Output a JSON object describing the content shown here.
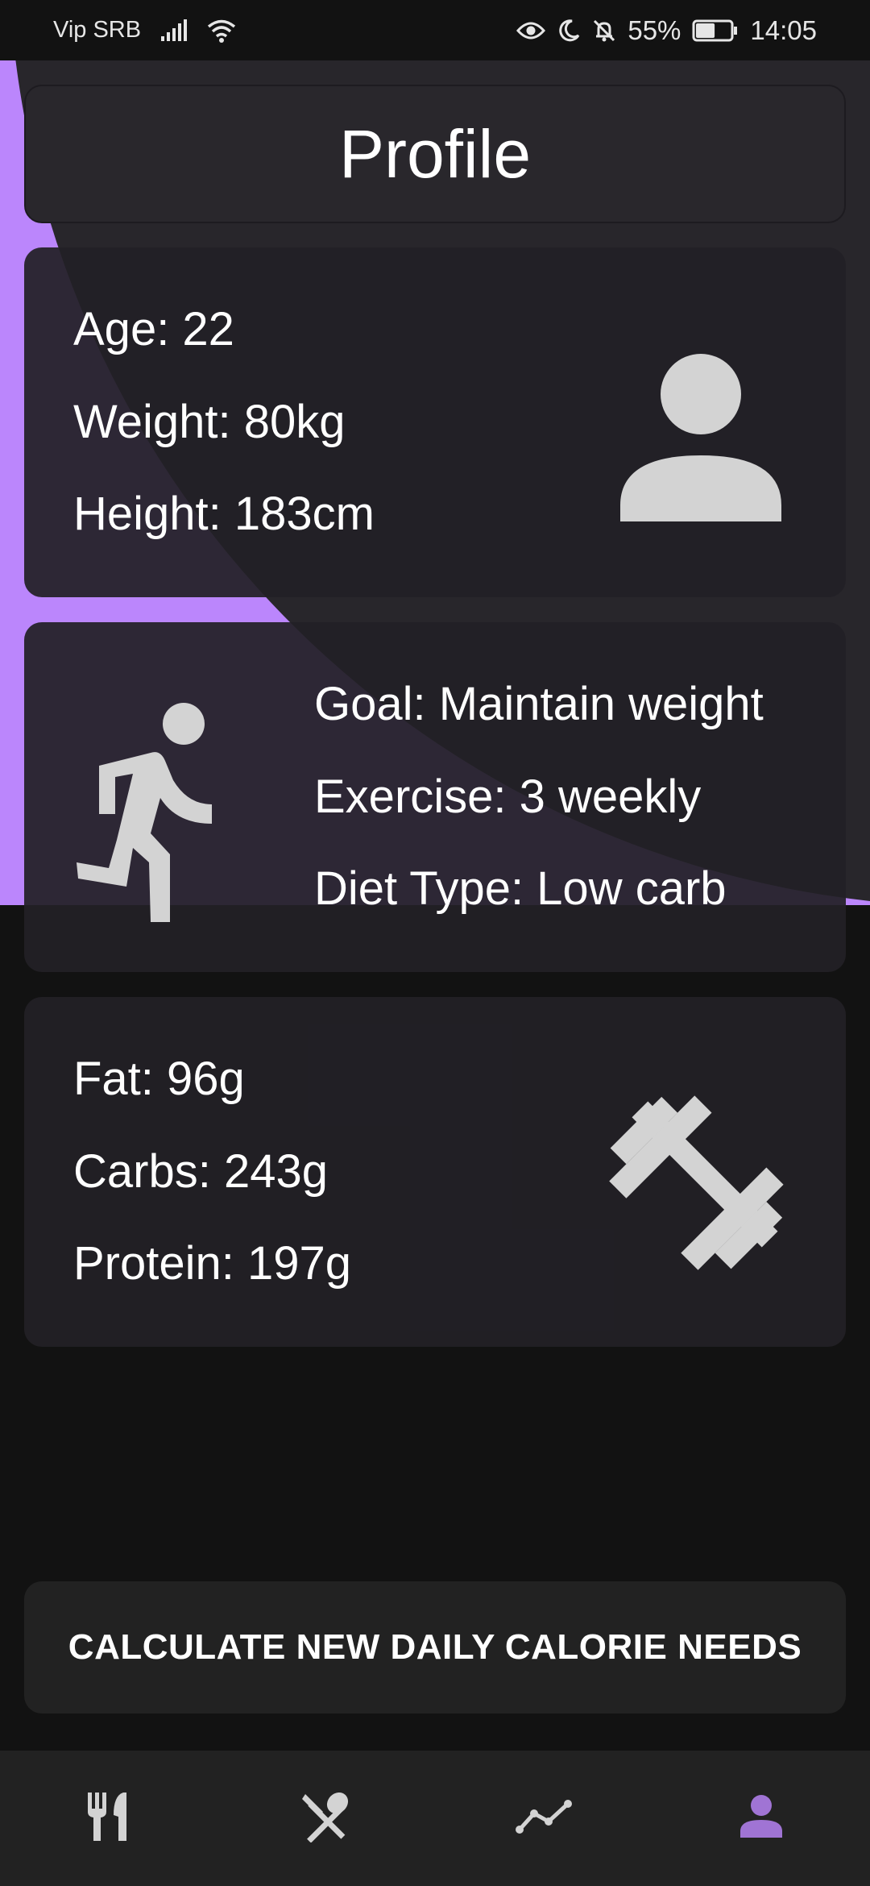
{
  "status_bar": {
    "carrier": "Vip SRB",
    "battery_percent": "55%",
    "battery_level": 0.55,
    "time": "14:05",
    "icons": [
      "signal-icon",
      "wifi-icon",
      "eye-icon",
      "moon-icon",
      "bell-off-icon",
      "battery-icon"
    ]
  },
  "header": {
    "title": "Profile"
  },
  "profile_card": {
    "age": "Age: 22",
    "weight": "Weight: 80kg",
    "height": "Height: 183cm",
    "icon": "person-icon"
  },
  "goal_card": {
    "goal": "Goal: Maintain weight",
    "exercise": "Exercise: 3 weekly",
    "diet_type": "Diet Type: Low carb",
    "icon": "running-person-icon"
  },
  "macros_card": {
    "fat": "Fat: 96g",
    "carbs": "Carbs: 243g",
    "protein": "Protein: 197g",
    "icon": "dumbbell-icon"
  },
  "actions": {
    "calculate_label": "CALCULATE NEW DAILY CALORIE NEEDS"
  },
  "bottom_nav": {
    "items": [
      {
        "icon": "restaurant-icon",
        "active": false
      },
      {
        "icon": "dining-icon",
        "active": false
      },
      {
        "icon": "chart-line-icon",
        "active": false
      },
      {
        "icon": "person-icon",
        "active": true
      }
    ]
  },
  "colors": {
    "accent": "#bb86fc",
    "active_nav": "#a074d4",
    "background": "#121212",
    "surface": "#222222",
    "icon_gray": "#d3d3d3"
  }
}
